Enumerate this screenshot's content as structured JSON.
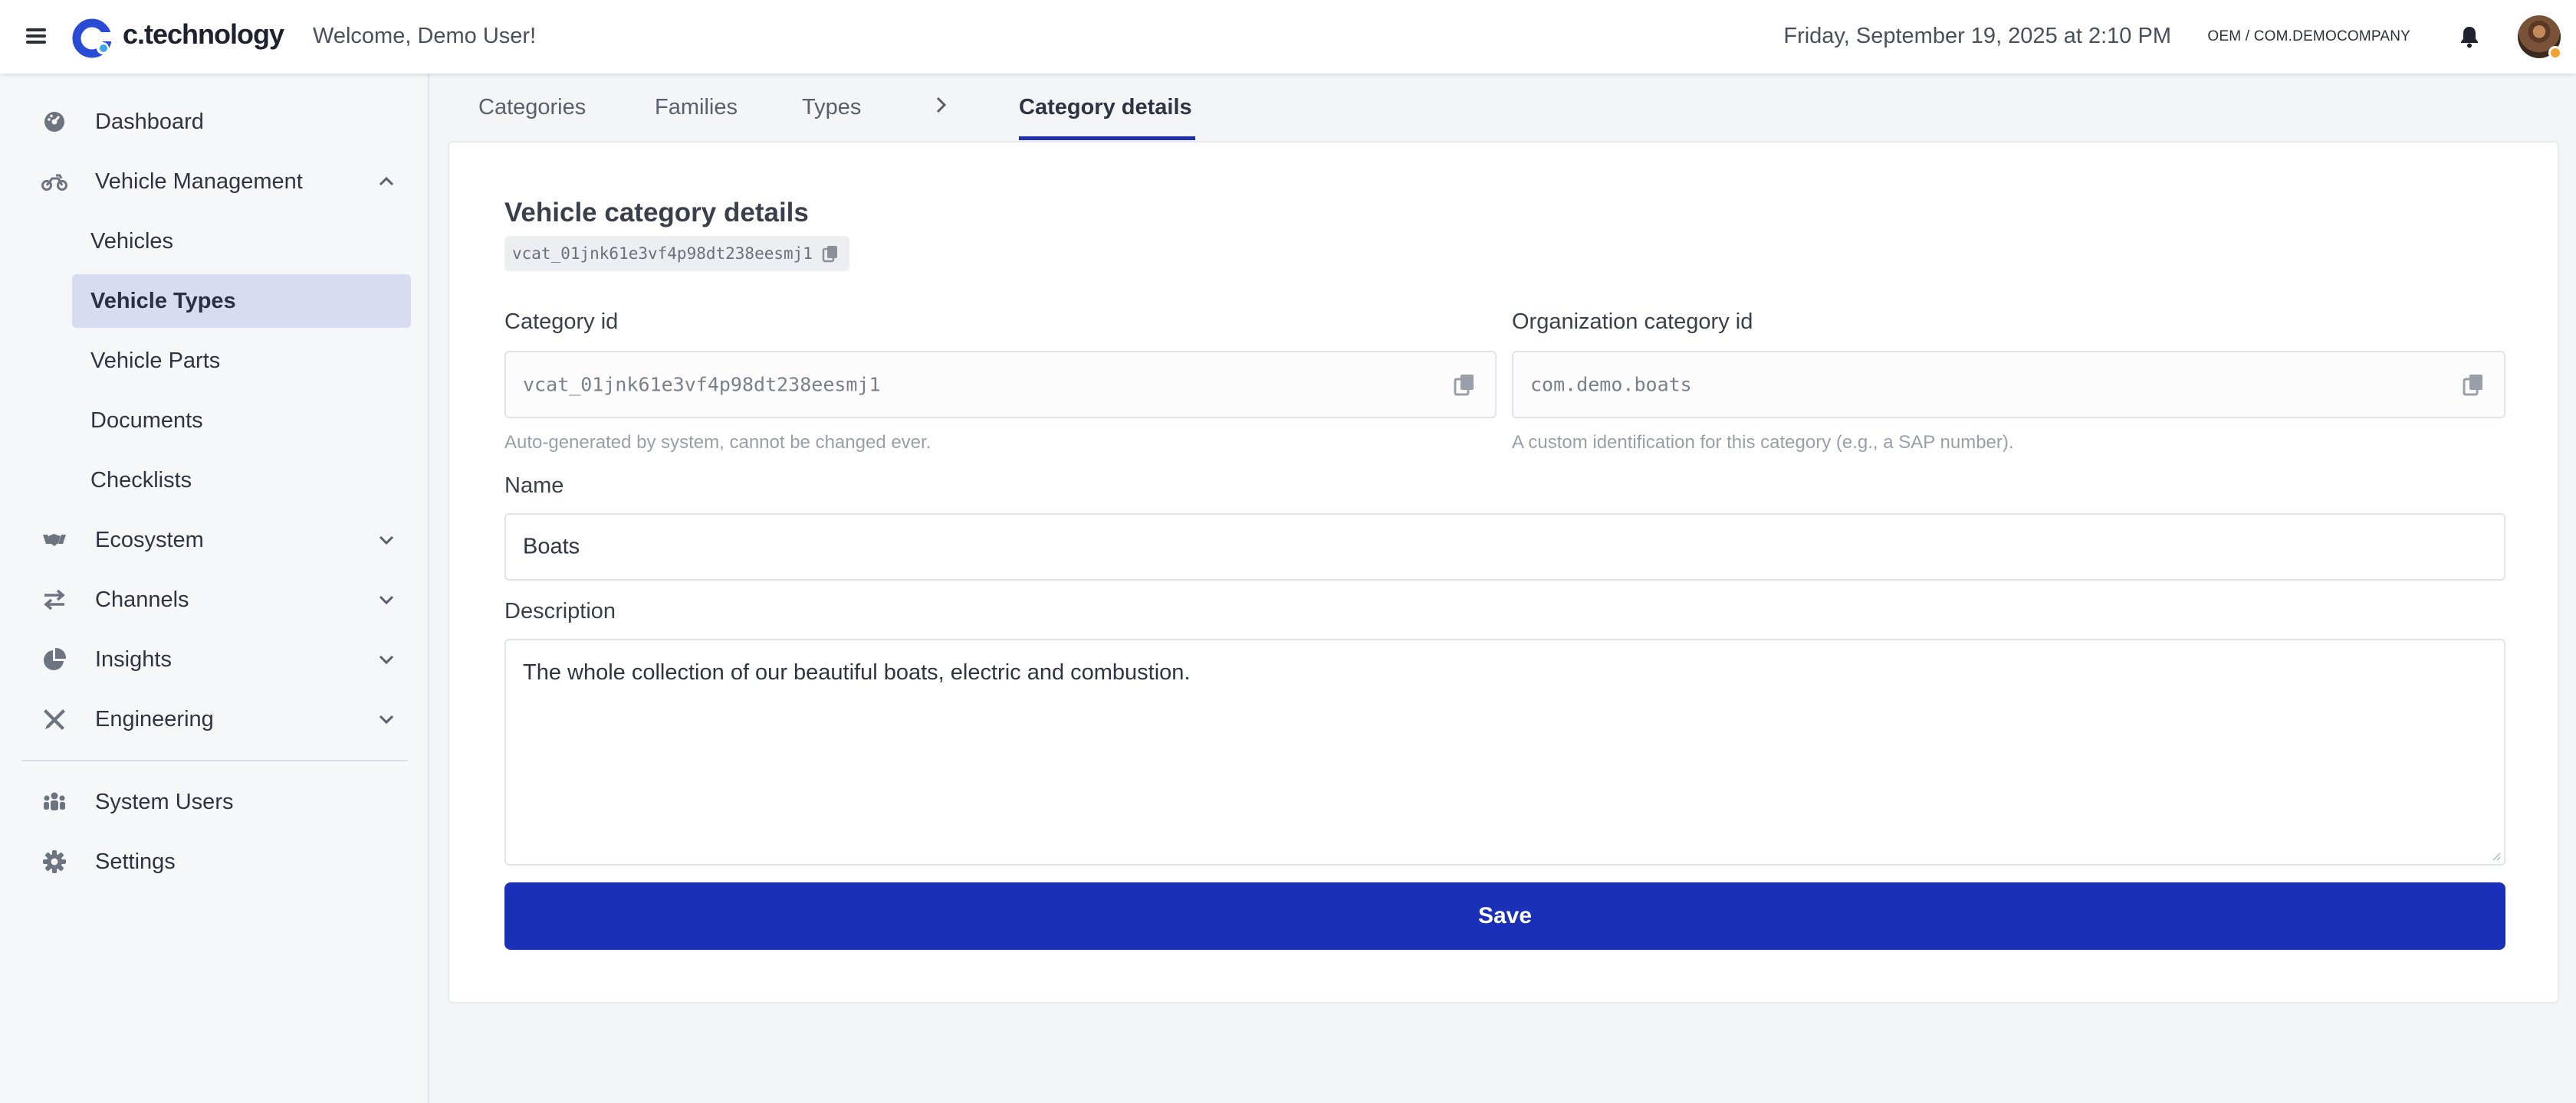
{
  "header": {
    "brand": "c.technology",
    "welcome": "Welcome, Demo User!",
    "datetime": "Friday, September 19, 2025 at 2:10 PM",
    "org": "OEM / COM.DEMOCOMPANY",
    "icons": [
      "menu-icon",
      "logo-icon",
      "bell-icon",
      "avatar"
    ],
    "accent_color": "#1a30b8",
    "status_dot_color": "#f0a22a"
  },
  "sidebar": {
    "items": [
      {
        "label": "Dashboard",
        "icon": "dashboard-icon"
      },
      {
        "label": "Vehicle Management",
        "icon": "motorbike-icon",
        "expanded": true,
        "children": [
          {
            "label": "Vehicles"
          },
          {
            "label": "Vehicle Types",
            "active": true
          },
          {
            "label": "Vehicle Parts"
          },
          {
            "label": "Documents"
          },
          {
            "label": "Checklists"
          }
        ]
      },
      {
        "label": "Ecosystem",
        "icon": "handshake-icon",
        "expanded": false
      },
      {
        "label": "Channels",
        "icon": "swap-arrows-icon",
        "expanded": false
      },
      {
        "label": "Insights",
        "icon": "pie-chart-icon",
        "expanded": false
      },
      {
        "label": "Engineering",
        "icon": "tools-icon",
        "expanded": false
      },
      {
        "label": "System Users",
        "icon": "users-icon"
      },
      {
        "label": "Settings",
        "icon": "gear-icon"
      }
    ],
    "active_bg_color": "#d7dcf0"
  },
  "tabs": [
    {
      "label": "Categories"
    },
    {
      "label": "Families"
    },
    {
      "label": "Types"
    },
    {
      "label": "Category details",
      "active": true
    }
  ],
  "form": {
    "title": "Vehicle category details",
    "id_chip": "vcat_01jnk61e3vf4p98dt238eesmj1",
    "category_id": {
      "label": "Category id",
      "value": "vcat_01jnk61e3vf4p98dt238eesmj1",
      "helper": "Auto-generated by system, cannot be changed ever."
    },
    "org_category_id": {
      "label": "Organization category id",
      "value": "com.demo.boats",
      "helper": "A custom identification for this category (e.g., a SAP number)."
    },
    "name": {
      "label": "Name",
      "value": "Boats"
    },
    "description": {
      "label": "Description",
      "value": "The whole collection of our beautiful boats, electric and combustion."
    },
    "save_label": "Save"
  }
}
